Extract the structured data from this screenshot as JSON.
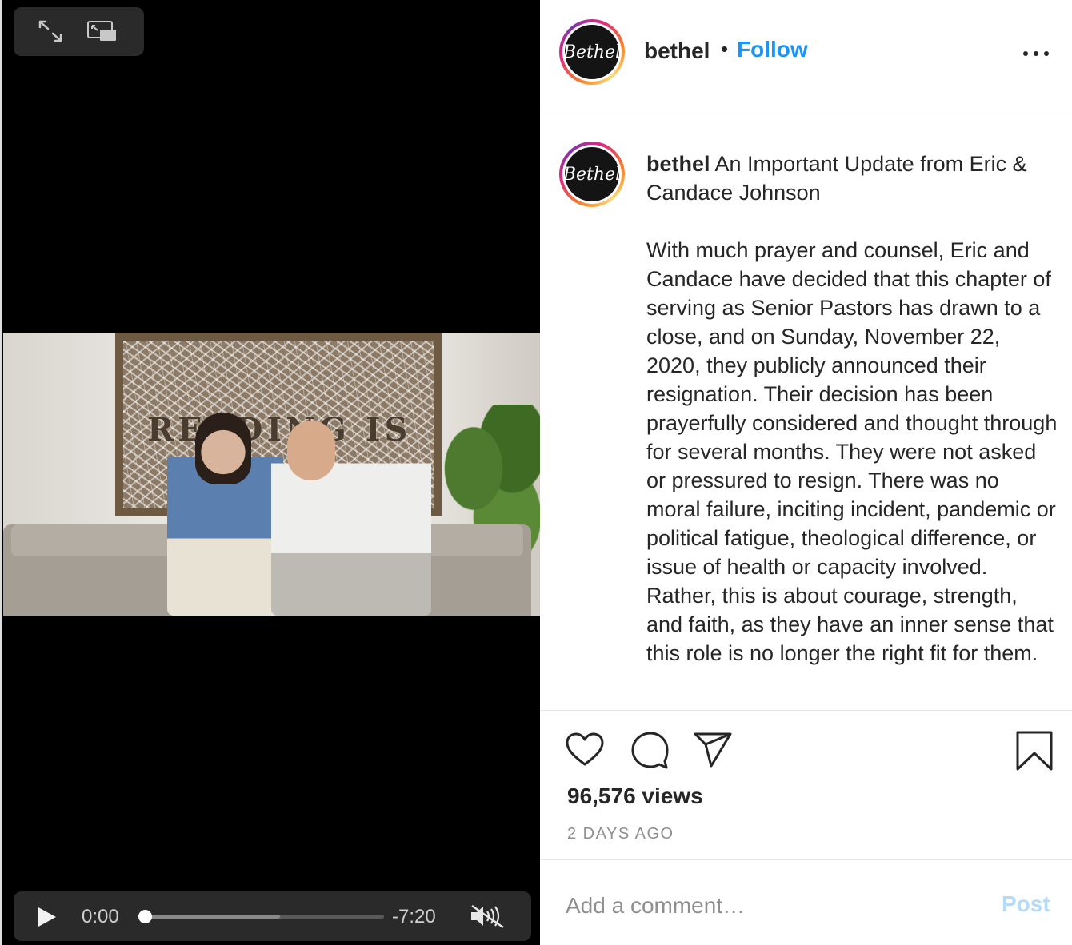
{
  "video": {
    "current_time": "0:00",
    "remaining_time": "-7:20",
    "progress": 0.0,
    "buffered": 0.57,
    "wall_art_text": "READING IS",
    "muted": true
  },
  "post": {
    "username": "bethel",
    "avatar_text": "Bethel",
    "dot": "•",
    "follow_label": "Follow",
    "caption_title": "An Important Update from Eric & Candace Johnson",
    "caption_body": "With much prayer and counsel, Eric and Candace have decided that this chapter of serving as Senior Pastors has drawn to a close, and on Sunday, November 22, 2020, they publicly announced their resignation. Their decision has been prayerfully considered and thought through for several months. They were not asked or pressured to resign. There was no moral failure, inciting incident, pandemic or political fatigue, theological difference, or issue of health or capacity involved. Rather, this is about courage, strength, and faith, as they have an inner sense that this role is no longer the right fit for them.",
    "views": "96,576 views",
    "time_ago": "2 DAYS AGO"
  },
  "comment": {
    "placeholder": "Add a comment…",
    "post_label": "Post"
  },
  "colors": {
    "follow": "#1a95f5",
    "post_disabled": "#b3dbfb",
    "muted_text": "#8e8e8e"
  },
  "icons": [
    "expand-icon",
    "picture-in-picture-icon",
    "play-icon",
    "muted-speaker-icon",
    "heart-icon",
    "comment-icon",
    "share-icon",
    "bookmark-icon",
    "more-icon"
  ]
}
